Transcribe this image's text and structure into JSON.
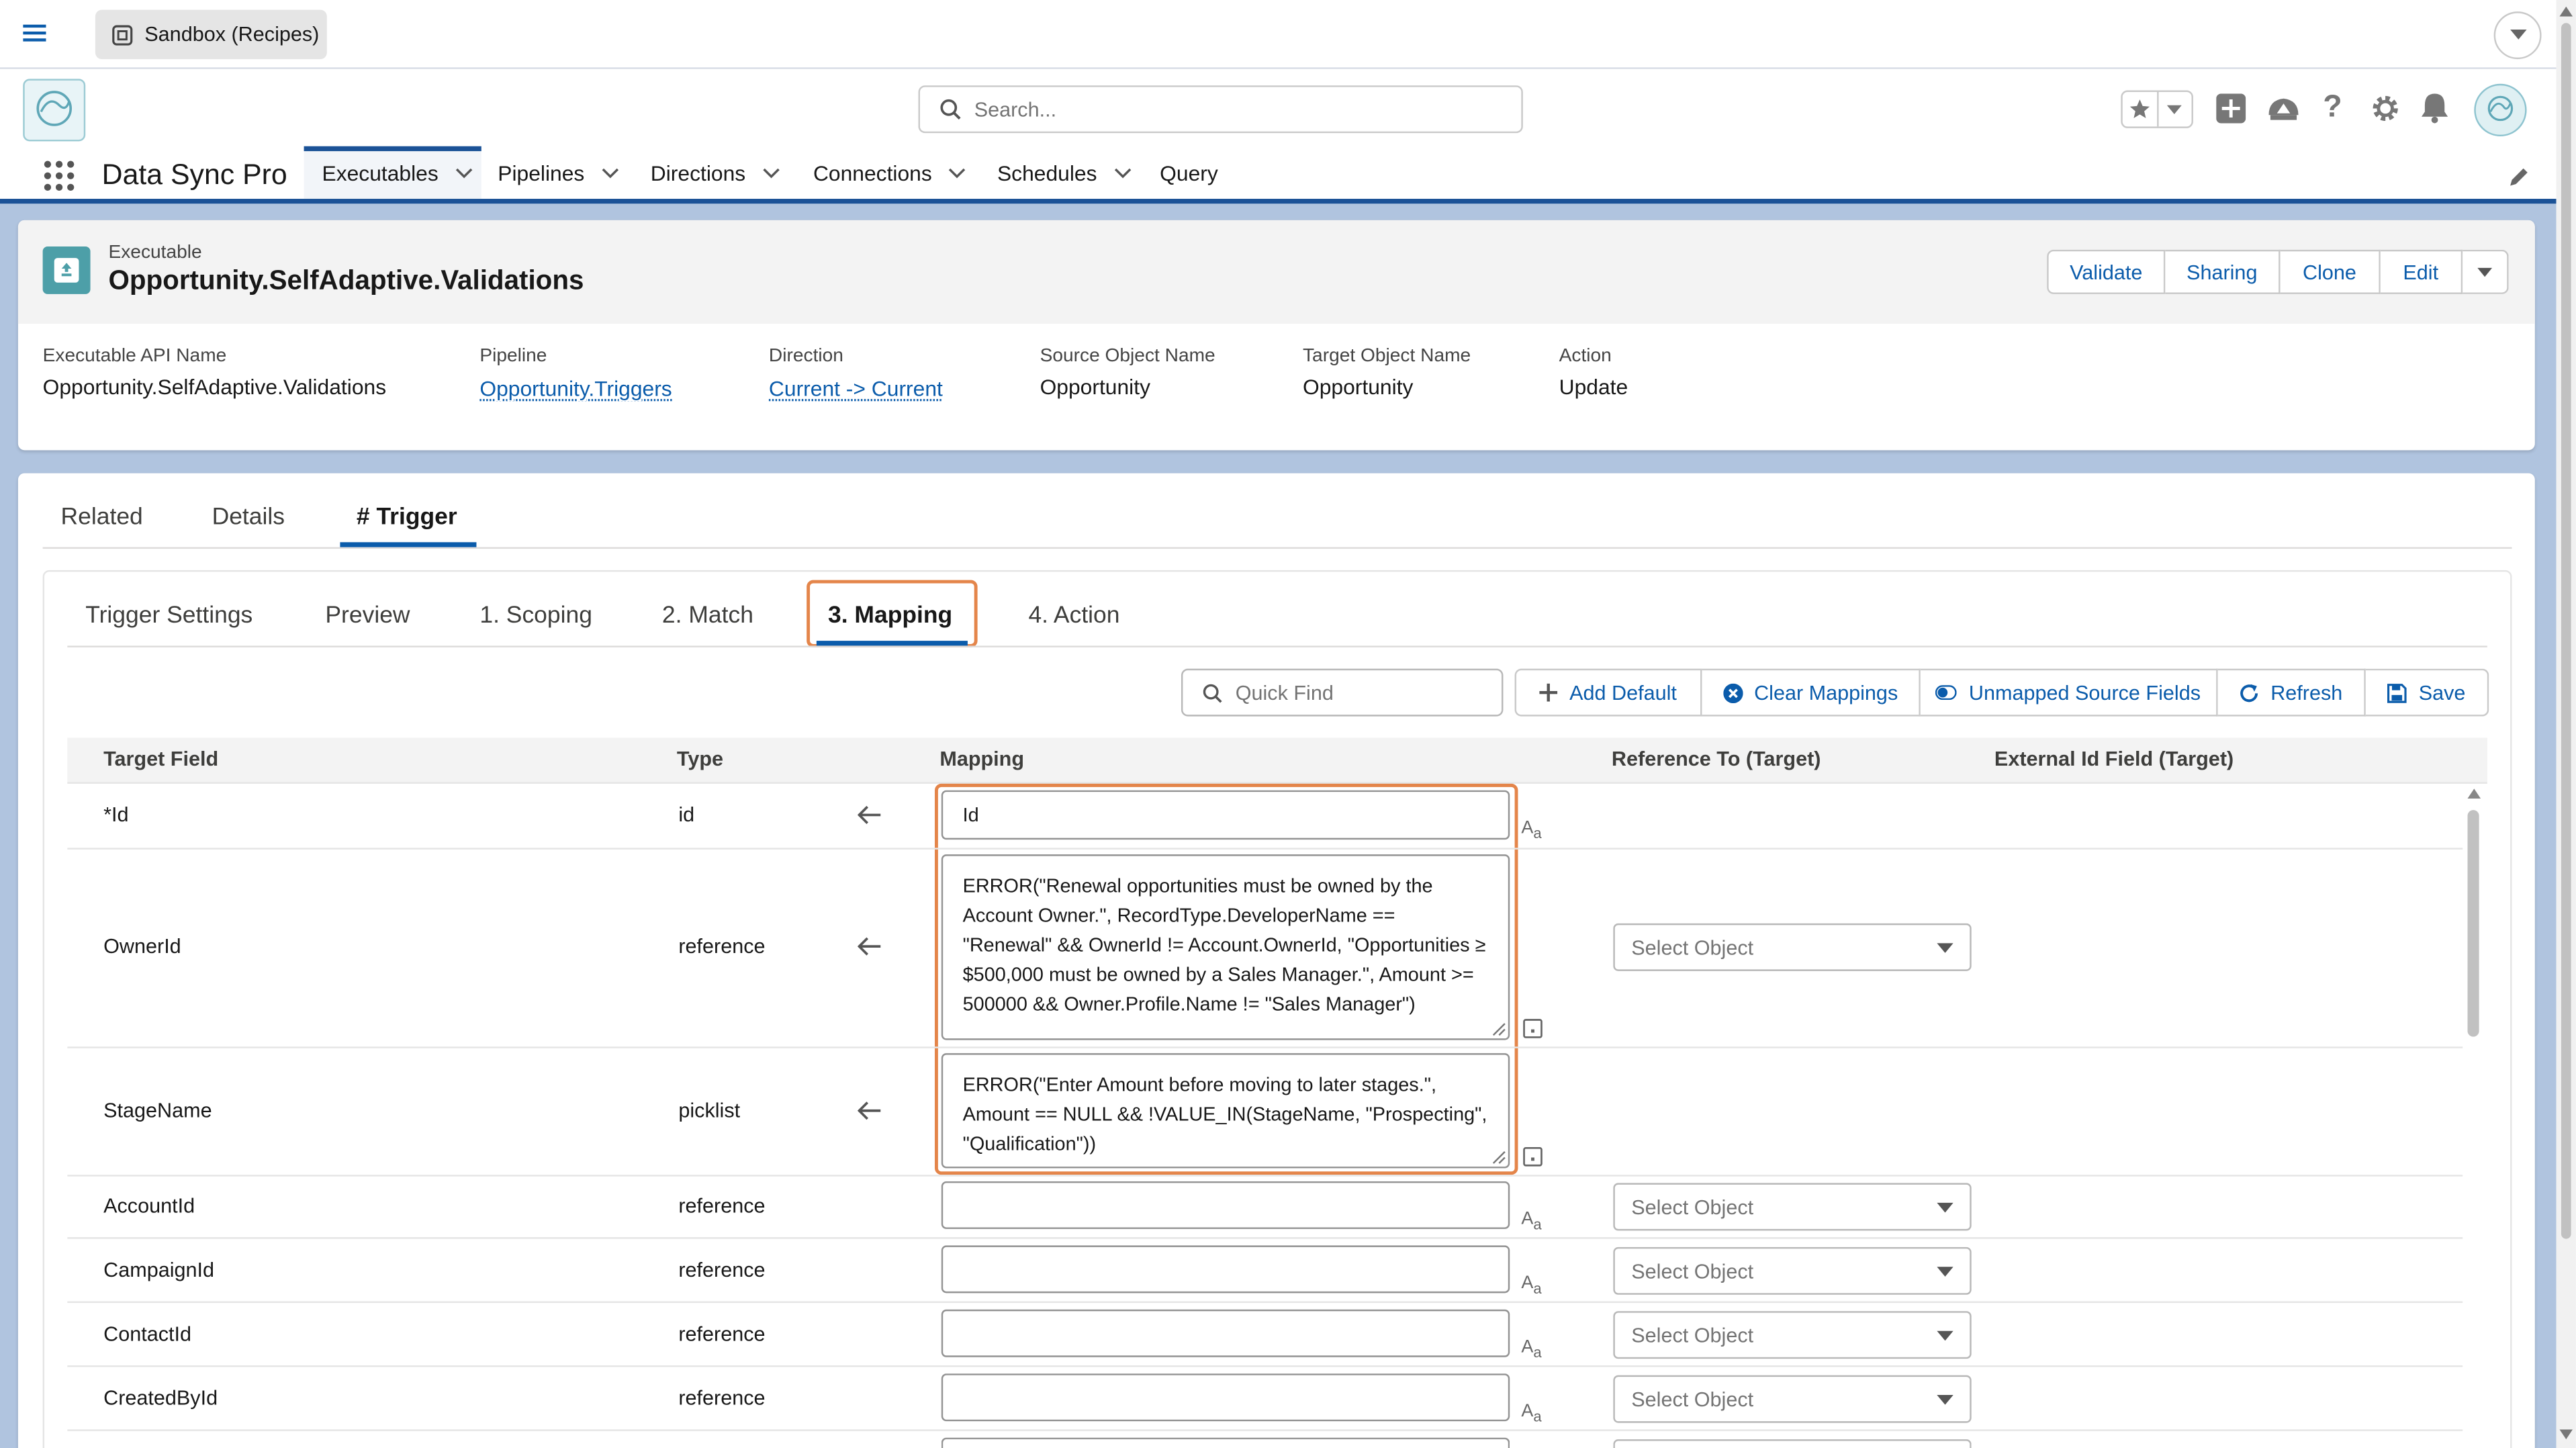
{
  "app": {
    "sandbox_label": "Sandbox (Recipes)",
    "app_name": "Data Sync Pro",
    "search_placeholder": "Search..."
  },
  "nav": [
    {
      "label": "Executables",
      "active": true
    },
    {
      "label": "Pipelines"
    },
    {
      "label": "Directions"
    },
    {
      "label": "Connections"
    },
    {
      "label": "Schedules"
    },
    {
      "label": "Query"
    }
  ],
  "record": {
    "object_label": "Executable",
    "name": "Opportunity.SelfAdaptive.Validations",
    "actions": [
      "Validate",
      "Sharing",
      "Clone",
      "Edit"
    ],
    "fields": [
      {
        "label": "Executable API Name",
        "value": "Opportunity.SelfAdaptive.Validations"
      },
      {
        "label": "Pipeline",
        "value": "Opportunity.Triggers"
      },
      {
        "label": "Direction",
        "value": "Current -> Current"
      },
      {
        "label": "Source Object Name",
        "value": "Opportunity"
      },
      {
        "label": "Target Object Name",
        "value": "Opportunity"
      },
      {
        "label": "Action",
        "value": "Update"
      }
    ]
  },
  "tabs": [
    "Related",
    "Details",
    "# Trigger"
  ],
  "subtabs": [
    "Trigger Settings",
    "Preview",
    "1. Scoping",
    "2. Match",
    "3. Mapping",
    "4. Action"
  ],
  "toolbar": {
    "quick_find_placeholder": "Quick Find",
    "add_default": "Add Default",
    "clear_mappings": "Clear Mappings",
    "unmapped_source_fields": "Unmapped Source Fields",
    "refresh": "Refresh",
    "save": "Save"
  },
  "table": {
    "headers": [
      "Target Field",
      "Type",
      "Mapping",
      "Reference To (Target)",
      "External Id Field (Target)"
    ],
    "select_placeholder": "Select Object",
    "rows": [
      {
        "field": "*Id",
        "type": "id",
        "mapping": "Id"
      },
      {
        "field": "OwnerId",
        "type": "reference",
        "mapping": "ERROR(\"Renewal opportunities must be owned by the Account Owner.\", RecordType.DeveloperName == \"Renewal\" && OwnerId != Account.OwnerId, \"Opportunities ≥ $500,000 must be owned by a Sales Manager.\", Amount >= 500000 && Owner.Profile.Name != \"Sales Manager\")"
      },
      {
        "field": "StageName",
        "type": "picklist",
        "mapping": "ERROR(\"Enter Amount before moving to later stages.\", Amount == NULL && !VALUE_IN(StageName, \"Prospecting\", \"Qualification\"))"
      },
      {
        "field": "AccountId",
        "type": "reference",
        "mapping": ""
      },
      {
        "field": "CampaignId",
        "type": "reference",
        "mapping": ""
      },
      {
        "field": "ContactId",
        "type": "reference",
        "mapping": ""
      },
      {
        "field": "CreatedById",
        "type": "reference",
        "mapping": ""
      }
    ]
  },
  "colors": {
    "brand_blue": "#0b5cab",
    "nav_underline": "#1b5297",
    "highlight_orange": "#e4854a",
    "page_background": "#b0c4df"
  }
}
